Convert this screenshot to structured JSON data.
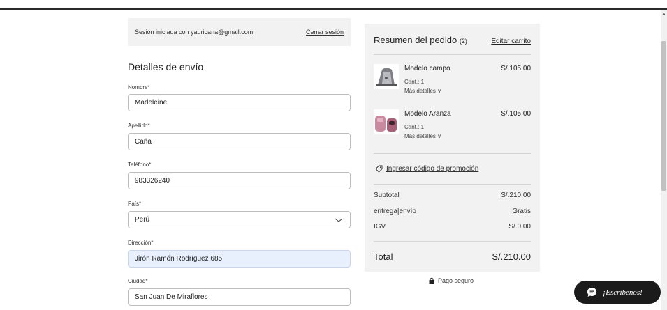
{
  "session": {
    "text": "Sesión iniciada con yauricana@gmail.com",
    "logout": "Cerrar sesión"
  },
  "shipping": {
    "title": "Detalles de envío",
    "fields": [
      {
        "label": "Nombre*",
        "value": "Madeleine"
      },
      {
        "label": "Apellido*",
        "value": "Caña"
      },
      {
        "label": "Teléfono*",
        "value": "983326240"
      },
      {
        "label": "País*",
        "value": "Perú"
      },
      {
        "label": "Dirección*",
        "value": "Jirón Ramón Rodríguez 685"
      },
      {
        "label": "Ciudad*",
        "value": "San Juan De Miraflores"
      }
    ]
  },
  "summary": {
    "title": "Resumen del pedido",
    "count": "(2)",
    "edit_cart": "Editar carrito",
    "items": [
      {
        "name": "Modelo campo",
        "price": "S/.105.00",
        "qty": "Cant.: 1",
        "more": "Más detalles",
        "icon": "backpack-gray"
      },
      {
        "name": "Modelo Aranza",
        "price": "S/.105.00",
        "qty": "Cant.: 1",
        "more": "Más detalles",
        "icon": "backpack-pink"
      }
    ],
    "promo": "Ingresar código de promoción",
    "subtotal_label": "Subtotal",
    "subtotal_value": "S/.210.00",
    "shipping_label": "entrega|envío",
    "shipping_value": "Gratis",
    "tax_label": "IGV",
    "tax_value": "S/.0.00",
    "total_label": "Total",
    "total_value": "S/.210.00"
  },
  "secure": "Pago seguro",
  "chat": "¡Escríbenos!",
  "colors": {
    "panel": "#f2f2f2",
    "autofill": "#e8f0fe",
    "chat_bg": "#1b1b1b"
  }
}
